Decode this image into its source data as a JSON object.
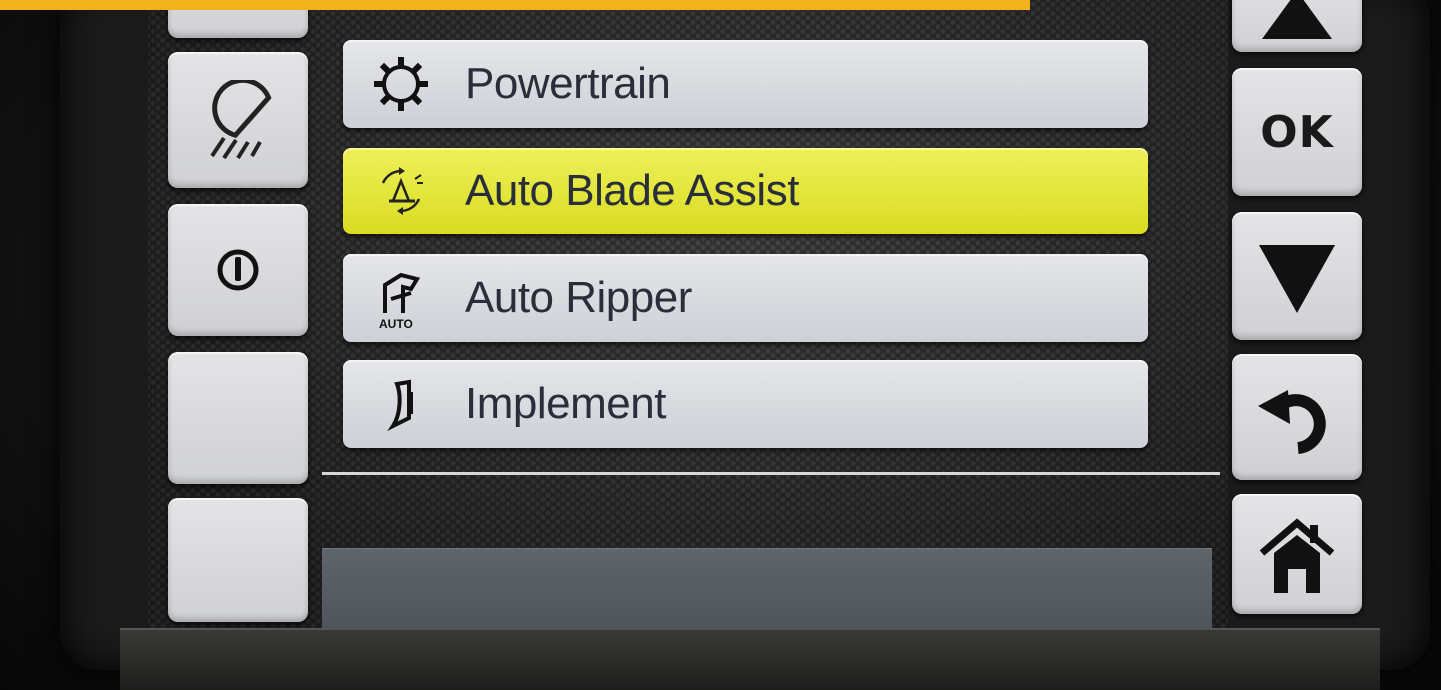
{
  "menu": {
    "items": [
      {
        "label": "Powertrain",
        "icon": "gear-icon",
        "selected": false
      },
      {
        "label": "Auto Blade Assist",
        "icon": "auto-blade-assist-icon",
        "selected": true
      },
      {
        "label": "Auto Ripper",
        "icon": "auto-ripper-icon",
        "selected": false,
        "icon_caption": "AUTO"
      },
      {
        "label": "Implement",
        "icon": "implement-icon",
        "selected": false
      }
    ]
  },
  "left_buttons": [
    {
      "icon": "work-lights-icon"
    },
    {
      "icon": "power-icon"
    },
    {
      "icon": "blank"
    },
    {
      "icon": "blank"
    }
  ],
  "right_buttons": [
    {
      "icon": "arrow-up-icon"
    },
    {
      "label": "OK"
    },
    {
      "icon": "arrow-down-icon"
    },
    {
      "icon": "back-icon"
    },
    {
      "icon": "home-icon"
    }
  ],
  "colors": {
    "selected_highlight": "#e3e63a",
    "item_background": "#dcdee3",
    "button_background": "#dadbde",
    "top_strip": "#f2b21c",
    "text": "#2a2e3a"
  }
}
